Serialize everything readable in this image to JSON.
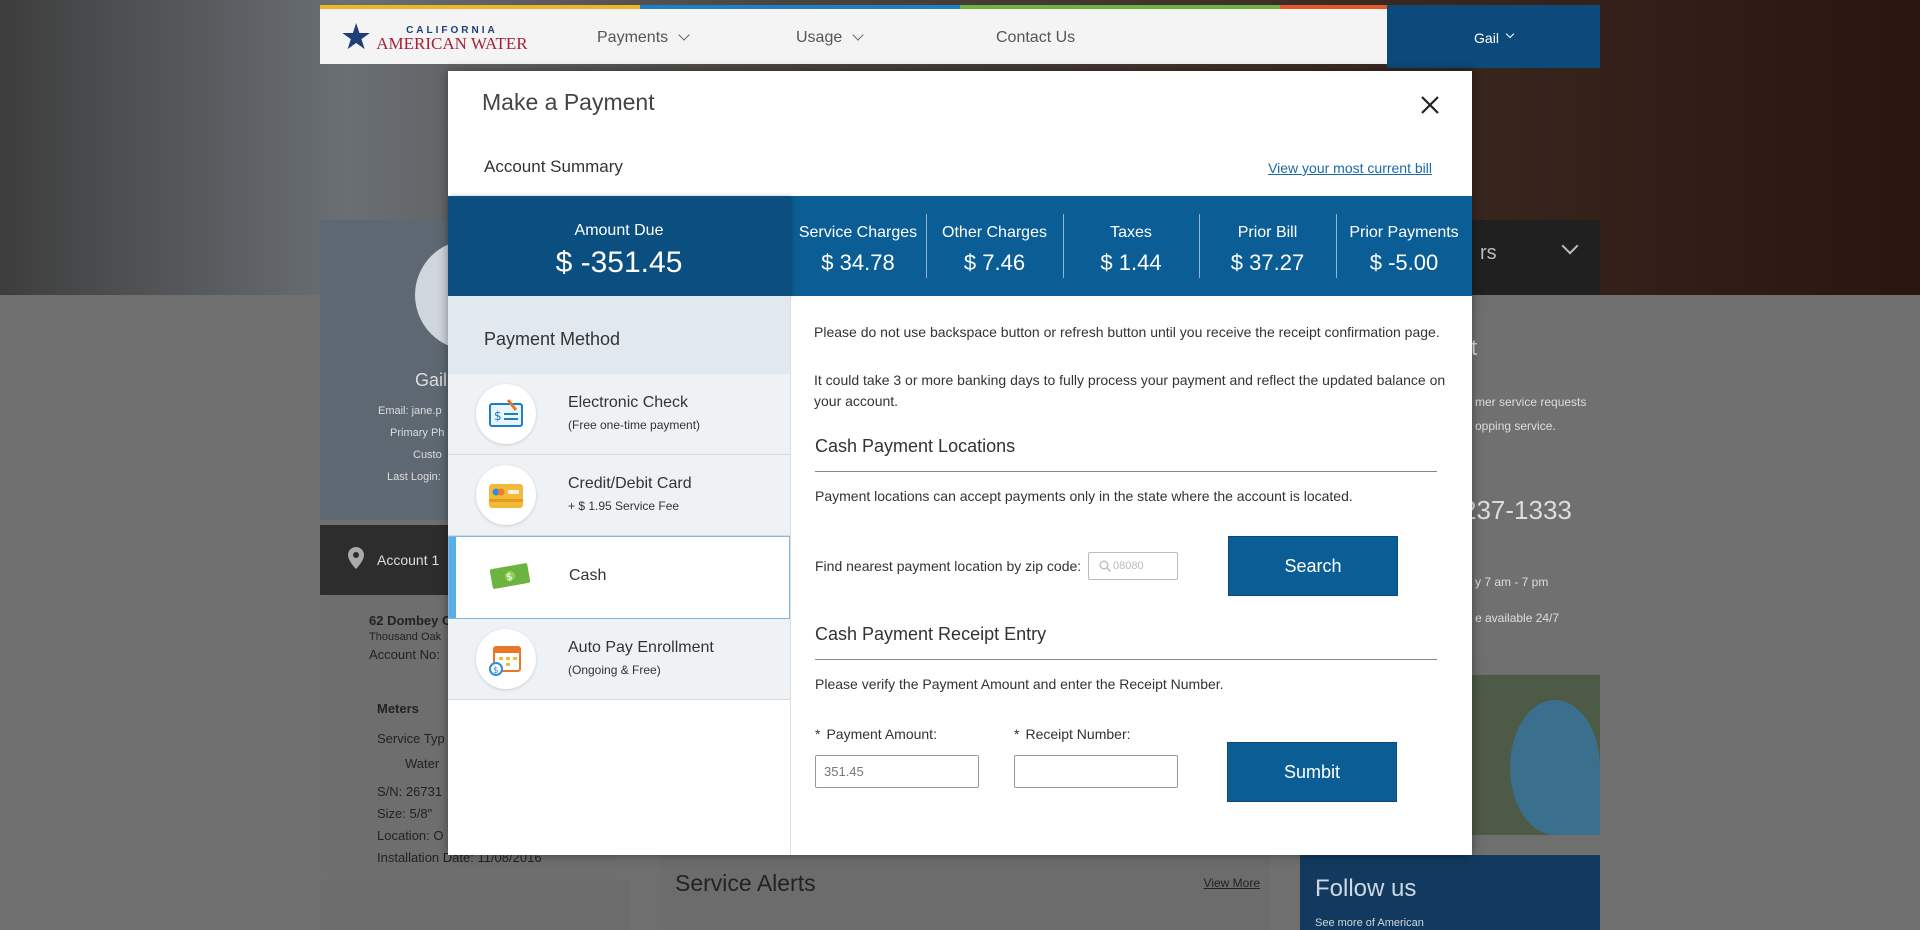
{
  "background": {
    "nav": {
      "brand_line1": "CALIFORNIA",
      "brand_line2": "AMERICAN WATER",
      "items": [
        {
          "label": "Payments"
        },
        {
          "label": "Usage"
        },
        {
          "label": "Contact Us"
        }
      ],
      "user": "Gail"
    },
    "profile": {
      "name": "Gail",
      "email": "Email: jane.p",
      "primary": "Primary Ph",
      "customer": "Custo",
      "last_login": "Last Login:"
    },
    "account_tab": "Account 1",
    "account": {
      "address": "62 Dombey C",
      "city": "Thousand Oak",
      "account_no": "Account No:",
      "meters_label": "Meters",
      "service_type": "Service Typ",
      "water": "Water",
      "sn": "S/N: 26731",
      "size": "Size: 5/8\"",
      "location": "Location: O",
      "install_date": "Installation Date: 11/08/2016"
    },
    "right_card": {
      "title_fragment": "st",
      "line1": "mer service requests",
      "line2": "opping service.",
      "phone": "237-1333",
      "hours": "y 7 am - 7 pm",
      "avail": "e available 24/7"
    },
    "right_dark_fragment": "rs",
    "follow_title": "Follow us",
    "follow_sub": "See more of American",
    "service_alerts": "Service Alerts",
    "view_more": "View More"
  },
  "modal": {
    "title": "Make a Payment",
    "account_summary_label": "Account Summary",
    "view_bill_link": "View your most current bill",
    "amount_due": {
      "label": "Amount Due",
      "value": "$ -351.45"
    },
    "charges": [
      {
        "label": "Service Charges",
        "value": "$ 34.78"
      },
      {
        "label": "Other Charges",
        "value": "$ 7.46"
      },
      {
        "label": "Taxes",
        "value": "$ 1.44"
      },
      {
        "label": "Prior Bill",
        "value": "$ 37.27"
      },
      {
        "label": "Prior Payments",
        "value": "$ -5.00"
      }
    ],
    "payment_method_label": "Payment Method",
    "methods": [
      {
        "name": "Electronic Check",
        "sub": "(Free one-time payment)",
        "icon": "check-icon"
      },
      {
        "name": "Credit/Debit Card",
        "sub": "+ $ 1.95 Service Fee",
        "icon": "credit-card-icon"
      },
      {
        "name": "Cash",
        "sub": "",
        "icon": "cash-icon",
        "selected": true
      },
      {
        "name": "Auto Pay Enrollment",
        "sub": "(Ongoing & Free)",
        "icon": "calendar-icon"
      }
    ],
    "notice1": "Please do not use backspace button or refresh button until you receive the receipt confirmation page.",
    "notice2": "It could take 3 or more banking days to fully process your payment and reflect the updated balance on your account.",
    "cash_locations": {
      "title": "Cash Payment Locations",
      "text": "Payment locations can accept payments only in the state where the account is located.",
      "zip_label": "Find nearest payment location by zip code:",
      "zip_placeholder": "08080",
      "search_button": "Search"
    },
    "receipt_entry": {
      "title": "Cash Payment Receipt Entry",
      "text": "Please verify the Payment Amount and enter the Receipt Number.",
      "amount_label": "Payment Amount",
      "amount_value": "351.45",
      "receipt_label": "Receipt Number",
      "receipt_value": "",
      "submit_button": "Sumbit",
      "required_mark": "*",
      "label_colon": ":"
    }
  },
  "colors": {
    "primary_blue": "#0b5e95",
    "amount_due_blue": "#0a4f80",
    "link_blue": "#1b6aa8",
    "selected_accent": "#5aaee6"
  }
}
